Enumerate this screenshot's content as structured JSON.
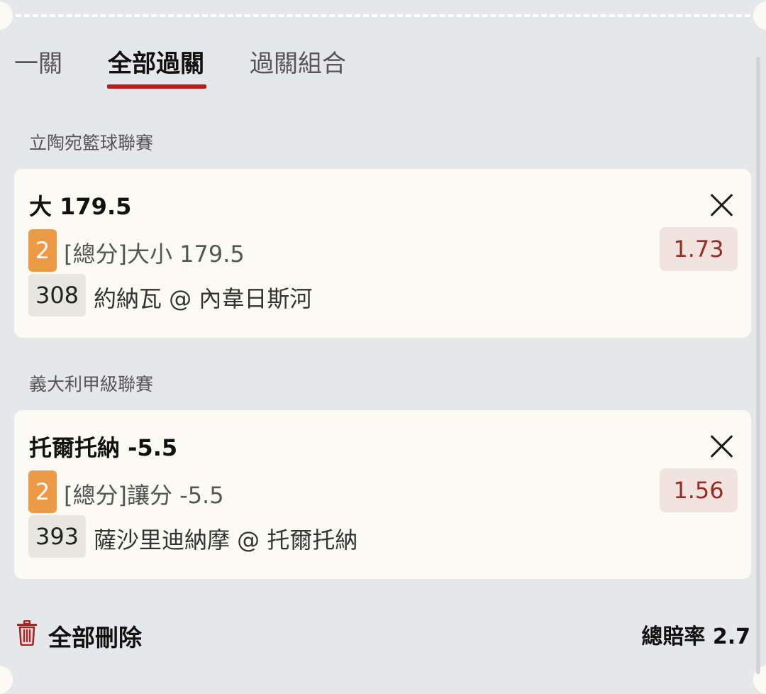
{
  "tabs": [
    {
      "label": "一關"
    },
    {
      "label": "全部過關"
    },
    {
      "label": "過關組合"
    }
  ],
  "active_tab": "全部過關",
  "accent_color": "#b0201e",
  "bets": [
    {
      "league": "立陶宛籃球聯賽",
      "selection": "大 179.5",
      "period": "2",
      "market": "[總分]大小 179.5",
      "odds": "1.73",
      "match_no": "308",
      "match": "約納瓦 @ 內韋日斯河"
    },
    {
      "league": "義大利甲級聯賽",
      "selection": "托爾托納 -5.5",
      "period": "2",
      "market": "[總分]讓分 -5.5",
      "odds": "1.56",
      "match_no": "393",
      "match": "薩沙里迪納摩 @ 托爾托納"
    }
  ],
  "footer": {
    "delete_all_label": "全部刪除",
    "total_odds_label": "總賠率",
    "total_odds_value": "2.7"
  },
  "icons": {
    "close": "close-icon",
    "trash": "trash-icon"
  }
}
